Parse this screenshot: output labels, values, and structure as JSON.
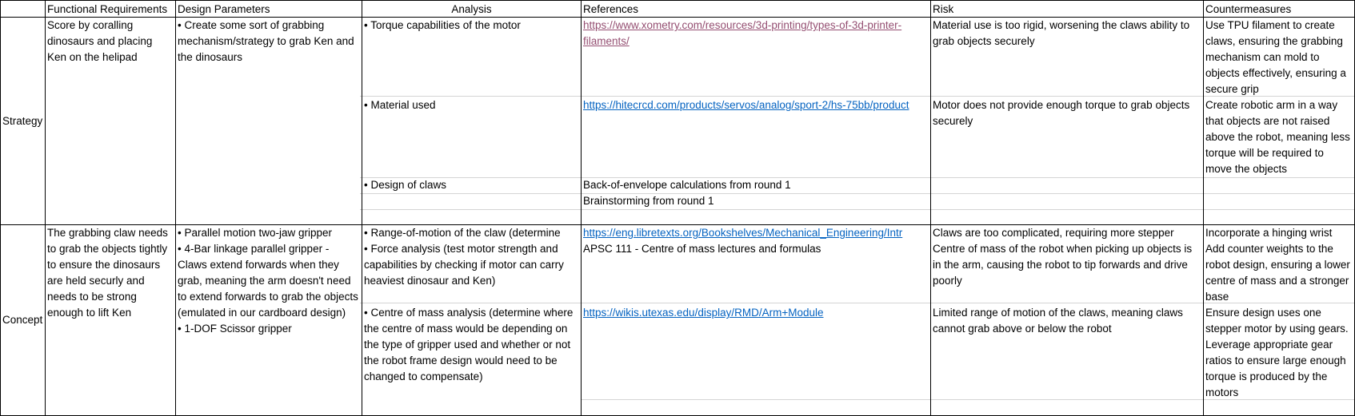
{
  "headers": {
    "functional": "Functional Requirements",
    "design": "Design Parameters",
    "analysis": "Analysis",
    "references": "References",
    "risk": "Risk",
    "countermeasures": "Countermeasures"
  },
  "strategy": {
    "label": "Strategy",
    "functional": "Score by coralling dinosaurs and placing Ken on the helipad",
    "design": "• Create some sort of grabbing mechanism/strategy to grab Ken and the dinosaurs",
    "rows": [
      {
        "analysis": "• Torque capabilities of the motor",
        "reference": "https://www.xometry.com/resources/3d-printing/types-of-3d-printer-filaments/",
        "risk": "Material use is too rigid, worsening the claws ability to grab objects securely",
        "countermeasure": "Use TPU filament to create claws, ensuring the grabbing mechanism can mold to objects effectively, ensuring a secure grip"
      },
      {
        "analysis": "• Material used",
        "reference": "https://hitecrcd.com/products/servos/analog/sport-2/hs-75bb/product",
        "risk": "Motor does not provide enough torque to grab objects securely",
        "countermeasure": "Create robotic arm in a way that objects are not raised above the robot, meaning less torque will be required to move the objects"
      },
      {
        "analysis": "• Design of claws",
        "reference": "Back-of-envelope calculations from round 1",
        "reference2": "Brainstorming from round 1"
      }
    ]
  },
  "concept": {
    "label": "Concept",
    "functional": "The grabbing claw needs to grab the objects tightly to ensure the dinosaurs are held securly and needs to be strong enough to lift Ken",
    "design": [
      "• Parallel motion two-jaw gripper",
      "• 4-Bar linkage parallel gripper  - Claws extend forwards when they grab, meaning the arm doesn't need to extend forwards to grab the objects (emulated in our cardboard design)",
      "• 1-DOF Scissor gripper"
    ],
    "rows": [
      {
        "analysis": "• Range-of-motion of the claw (determine",
        "reference": "https://eng.libretexts.org/Bookshelves/Mechanical_Engineering/Intr",
        "risk": "Claws are too complicated, requiring more stepper",
        "countermeasure": "Incorporate a hinging wrist"
      },
      {
        "analysis": "• Force analysis (test motor strength and capabilities by checking if motor can carry heaviest dinosaur and Ken)",
        "reference": "APSC 111 - Centre of mass lectures and formulas",
        "risk": "Centre of mass of the robot when picking up objects is in the arm, causing the robot to tip forwards and drive poorly",
        "countermeasure": "Add counter weights to the robot design, ensuring a lower centre of mass and a stronger base"
      },
      {
        "analysis": "• Centre of mass analysis (determine where the centre of mass would be depending on the type of gripper used and whether or not the robot frame design would need to be changed to compensate)",
        "reference": "https://wikis.utexas.edu/display/RMD/Arm+Module",
        "risk": "Limited range of motion of the claws, meaning claws cannot grab above or below the robot",
        "countermeasure": "Ensure design uses one stepper motor by using gears. Leverage appropriate gear ratios to ensure large enough torque is produced by the motors"
      }
    ]
  },
  "colors": {
    "link": "#0563c1",
    "visited_link": "#954f72",
    "gridline": "#d4d4d4",
    "border": "#000000"
  }
}
